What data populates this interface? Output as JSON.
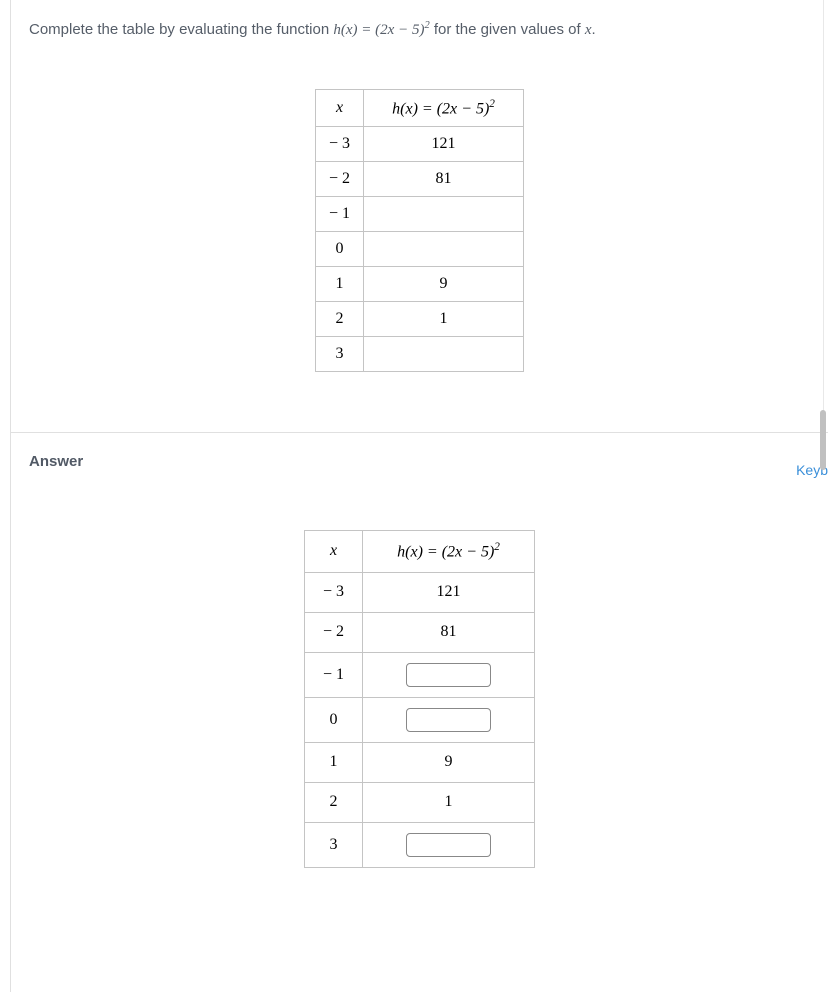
{
  "question": {
    "prefix": "Complete the table by evaluating the function ",
    "function": "h(x) = (2x − 5)²",
    "suffix": " for the given values of ",
    "variable": "x",
    "end": "."
  },
  "table1": {
    "header_x": "x",
    "header_hx_prefix": "h(x) = (2x − 5)",
    "header_hx_sup": "2",
    "rows": [
      {
        "x": "− 3",
        "hx": "121"
      },
      {
        "x": "− 2",
        "hx": "81"
      },
      {
        "x": "− 1",
        "hx": ""
      },
      {
        "x": "0",
        "hx": ""
      },
      {
        "x": "1",
        "hx": "9"
      },
      {
        "x": "2",
        "hx": "1"
      },
      {
        "x": "3",
        "hx": ""
      }
    ]
  },
  "answer_label": "Answer",
  "keyb_text": "Keyb",
  "table2": {
    "header_x": "x",
    "header_hx_prefix": "h(x) = (2x − 5)",
    "header_hx_sup": "2",
    "rows": [
      {
        "x": "− 3",
        "hx": "121",
        "input": false
      },
      {
        "x": "− 2",
        "hx": "81",
        "input": false
      },
      {
        "x": "− 1",
        "hx": "",
        "input": true
      },
      {
        "x": "0",
        "hx": "",
        "input": true
      },
      {
        "x": "1",
        "hx": "9",
        "input": false
      },
      {
        "x": "2",
        "hx": "1",
        "input": false
      },
      {
        "x": "3",
        "hx": "",
        "input": true
      }
    ]
  }
}
